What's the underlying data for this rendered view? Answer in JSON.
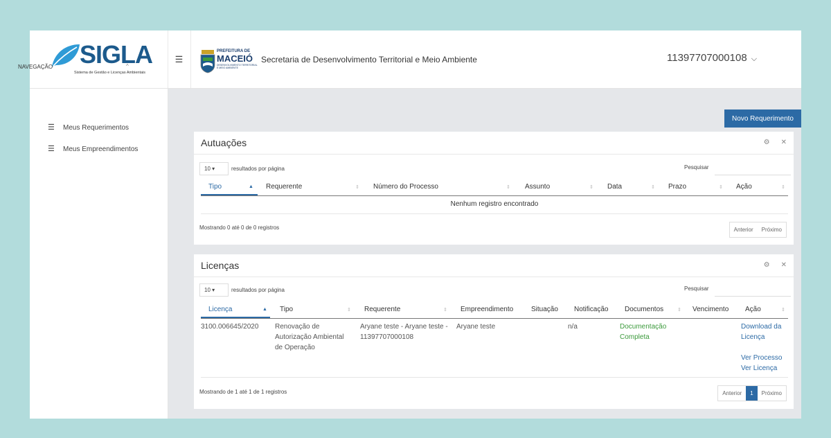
{
  "header": {
    "logo_text": "SIGLA",
    "logo_subtitle": "Sistema de Gestão e Licenças Ambientais",
    "prefeitura_top": "PREFEITURA DE",
    "prefeitura_city": "MACEIÓ",
    "prefeitura_small": "DESENVOLVIMENTO TERRITORIAL E MEIO AMBIENTE",
    "secretaria": "Secretaria de Desenvolvimento Territorial e Meio Ambiente",
    "user": "11397707000108"
  },
  "sidebar": {
    "heading": "NAVEGAÇÃO",
    "items": [
      {
        "label": "Meus Requerimentos",
        "icon": "list-icon"
      },
      {
        "label": "Meus Empreendimentos",
        "icon": "list-icon"
      }
    ]
  },
  "actions": {
    "novo": "Novo Requerimento"
  },
  "autuacoes": {
    "title": "Autuações",
    "page_size": "10",
    "page_size_label": "resultados por página",
    "search_label": "Pesquisar",
    "columns": [
      "Tipo",
      "Requerente",
      "Número do Processo",
      "Assunto",
      "Data",
      "Prazo",
      "Ação"
    ],
    "empty": "Nenhum registro encontrado",
    "info": "Mostrando 0 até 0 de 0 registros",
    "prev": "Anterior",
    "next": "Próximo"
  },
  "licencas": {
    "title": "Licenças",
    "page_size": "10",
    "page_size_label": "resultados por página",
    "search_label": "Pesquisar",
    "columns": [
      "Licença",
      "Tipo",
      "Requerente",
      "Empreendimento",
      "Situação",
      "Notificação",
      "Documentos",
      "Vencimento",
      "Ação"
    ],
    "rows": [
      {
        "licenca": "3100.006645/2020",
        "tipo": "Renovação de Autorização Ambiental de Operação",
        "requerente": "Aryane teste - Aryane teste - 11397707000108",
        "empreendimento": "Aryane teste",
        "situacao": "",
        "notificacao": "n/a",
        "documentos": "Documentação Completa",
        "vencimento": "",
        "acao_download": "Download da Licença",
        "acao_processo": "Ver Processo",
        "acao_licenca": "Ver Licença"
      }
    ],
    "info": "Mostrando de 1 até 1 de 1 registros",
    "prev": "Anterior",
    "page": "1",
    "next": "Próximo"
  },
  "colors": {
    "accent": "#2c6aa5",
    "success": "#3c9a3c",
    "background": "#b2dcdc"
  }
}
